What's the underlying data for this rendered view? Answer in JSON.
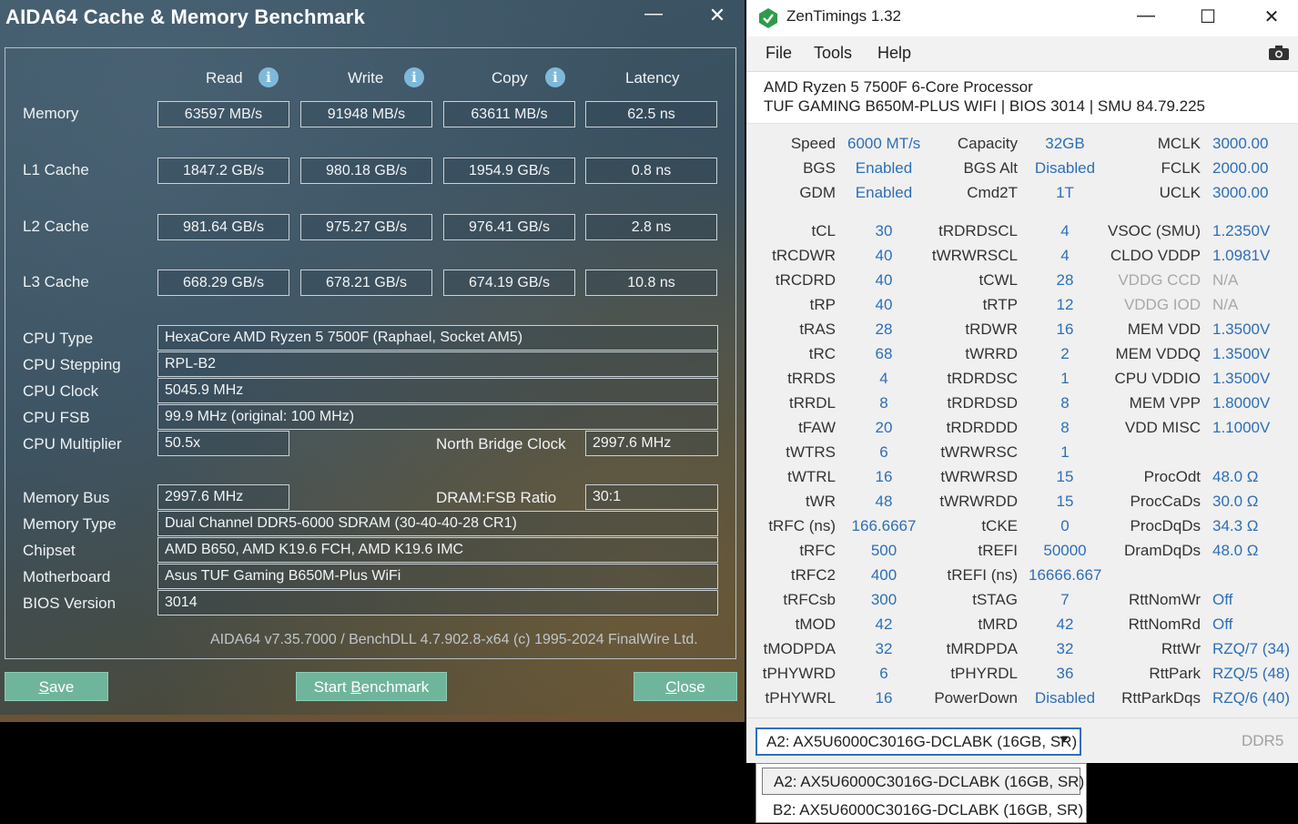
{
  "aida": {
    "title": "AIDA64 Cache & Memory Benchmark",
    "minimize": "—",
    "close": "✕",
    "columns": [
      "Read",
      "Write",
      "Copy",
      "Latency"
    ],
    "rows": [
      {
        "label": "Memory",
        "values": [
          "63597 MB/s",
          "91948 MB/s",
          "63611 MB/s",
          "62.5 ns"
        ]
      },
      {
        "label": "L1 Cache",
        "values": [
          "1847.2 GB/s",
          "980.18 GB/s",
          "1954.9 GB/s",
          "0.8 ns"
        ]
      },
      {
        "label": "L2 Cache",
        "values": [
          "981.64 GB/s",
          "975.27 GB/s",
          "976.41 GB/s",
          "2.8 ns"
        ]
      },
      {
        "label": "L3 Cache",
        "values": [
          "668.29 GB/s",
          "678.21 GB/s",
          "674.19 GB/s",
          "10.8 ns"
        ]
      }
    ],
    "cpu_type_label": "CPU Type",
    "cpu_type": "HexaCore AMD Ryzen 5 7500F  (Raphael, Socket AM5)",
    "cpu_stepping_label": "CPU Stepping",
    "cpu_stepping": "RPL-B2",
    "cpu_clock_label": "CPU Clock",
    "cpu_clock": "5045.9 MHz",
    "cpu_fsb_label": "CPU FSB",
    "cpu_fsb": "99.9 MHz  (original: 100 MHz)",
    "cpu_mult_label": "CPU Multiplier",
    "cpu_mult": "50.5x",
    "nb_clock_label": "North Bridge Clock",
    "nb_clock": "2997.6 MHz",
    "mem_bus_label": "Memory Bus",
    "mem_bus": "2997.6 MHz",
    "dram_ratio_label": "DRAM:FSB Ratio",
    "dram_ratio": "30:1",
    "mem_type_label": "Memory Type",
    "mem_type": "Dual Channel DDR5-6000 SDRAM  (30-40-40-28 CR1)",
    "chipset_label": "Chipset",
    "chipset": "AMD B650, AMD K19.6 FCH, AMD K19.6 IMC",
    "mobo_label": "Motherboard",
    "mobo": "Asus TUF Gaming B650M-Plus WiFi",
    "bios_label": "BIOS Version",
    "bios": "3014",
    "footer": "AIDA64 v7.35.7000 / BenchDLL 4.7.902.8-x64  (c) 1995-2024 FinalWire Ltd.",
    "btn_save_pre": "",
    "btn_save_u": "S",
    "btn_save_post": "ave",
    "btn_start_pre": "Start ",
    "btn_start_u": "B",
    "btn_start_post": "enchmark",
    "btn_close_pre": "",
    "btn_close_u": "C",
    "btn_close_post": "lose"
  },
  "zen": {
    "title": "ZenTimings 1.32",
    "menu": [
      "File",
      "Tools",
      "Help"
    ],
    "cpu": "AMD Ryzen 5 7500F 6-Core Processor",
    "mobo": "TUF GAMING B650M-PLUS WIFI | BIOS 3014 | SMU 84.79.225",
    "top": [
      [
        "Speed",
        "6000 MT/s",
        "Capacity",
        "32GB",
        "MCLK",
        "3000.00"
      ],
      [
        "BGS",
        "Enabled",
        "BGS Alt",
        "Disabled",
        "FCLK",
        "2000.00"
      ],
      [
        "GDM",
        "Enabled",
        "Cmd2T",
        "1T",
        "UCLK",
        "3000.00"
      ]
    ],
    "timings": [
      [
        "tCL",
        "30",
        "tRDRDSCL",
        "4",
        "VSOC (SMU)",
        "1.2350V"
      ],
      [
        "tRCDWR",
        "40",
        "tWRWRSCL",
        "4",
        "CLDO VDDP",
        "1.0981V"
      ],
      [
        "tRCDRD",
        "40",
        "tCWL",
        "28",
        "VDDG CCD",
        "N/A"
      ],
      [
        "tRP",
        "40",
        "tRTP",
        "12",
        "VDDG IOD",
        "N/A"
      ],
      [
        "tRAS",
        "28",
        "tRDWR",
        "16",
        "MEM VDD",
        "1.3500V"
      ],
      [
        "tRC",
        "68",
        "tWRRD",
        "2",
        "MEM VDDQ",
        "1.3500V"
      ],
      [
        "tRRDS",
        "4",
        "tRDRDSC",
        "1",
        "CPU VDDIO",
        "1.3500V"
      ],
      [
        "tRRDL",
        "8",
        "tRDRDSD",
        "8",
        "MEM VPP",
        "1.8000V"
      ],
      [
        "tFAW",
        "20",
        "tRDRDDD",
        "8",
        "VDD MISC",
        "1.1000V"
      ],
      [
        "tWTRS",
        "6",
        "tWRWRSC",
        "1",
        "",
        ""
      ],
      [
        "tWTRL",
        "16",
        "tWRWRSD",
        "15",
        "ProcOdt",
        "48.0 Ω"
      ],
      [
        "tWR",
        "48",
        "tWRWRDD",
        "15",
        "ProcCaDs",
        "30.0 Ω"
      ],
      [
        "tRFC (ns)",
        "166.6667",
        "tCKE",
        "0",
        "ProcDqDs",
        "34.3 Ω"
      ],
      [
        "tRFC",
        "500",
        "tREFI",
        "50000",
        "DramDqDs",
        "48.0 Ω"
      ],
      [
        "tRFC2",
        "400",
        "tREFI (ns)",
        "16666.667",
        "",
        ""
      ],
      [
        "tRFCsb",
        "300",
        "tSTAG",
        "7",
        "RttNomWr",
        "Off"
      ],
      [
        "tMOD",
        "42",
        "tMRD",
        "42",
        "RttNomRd",
        "Off"
      ],
      [
        "tMODPDA",
        "32",
        "tMRDPDA",
        "32",
        "RttWr",
        "RZQ/7 (34)"
      ],
      [
        "tPHYWRD",
        "6",
        "tPHYRDL",
        "36",
        "RttPark",
        "RZQ/5 (48)"
      ],
      [
        "tPHYWRL",
        "16",
        "PowerDown",
        "Disabled",
        "RttParkDqs",
        "RZQ/6 (40)"
      ]
    ],
    "module_selected": "A2: AX5U6000C3016G-DCLABK (16GB, SR)",
    "ddr": "DDR5",
    "module_options": [
      "A2: AX5U6000C3016G-DCLABK (16GB, SR)",
      "B2: AX5U6000C3016G-DCLABK (16GB, SR)"
    ]
  }
}
